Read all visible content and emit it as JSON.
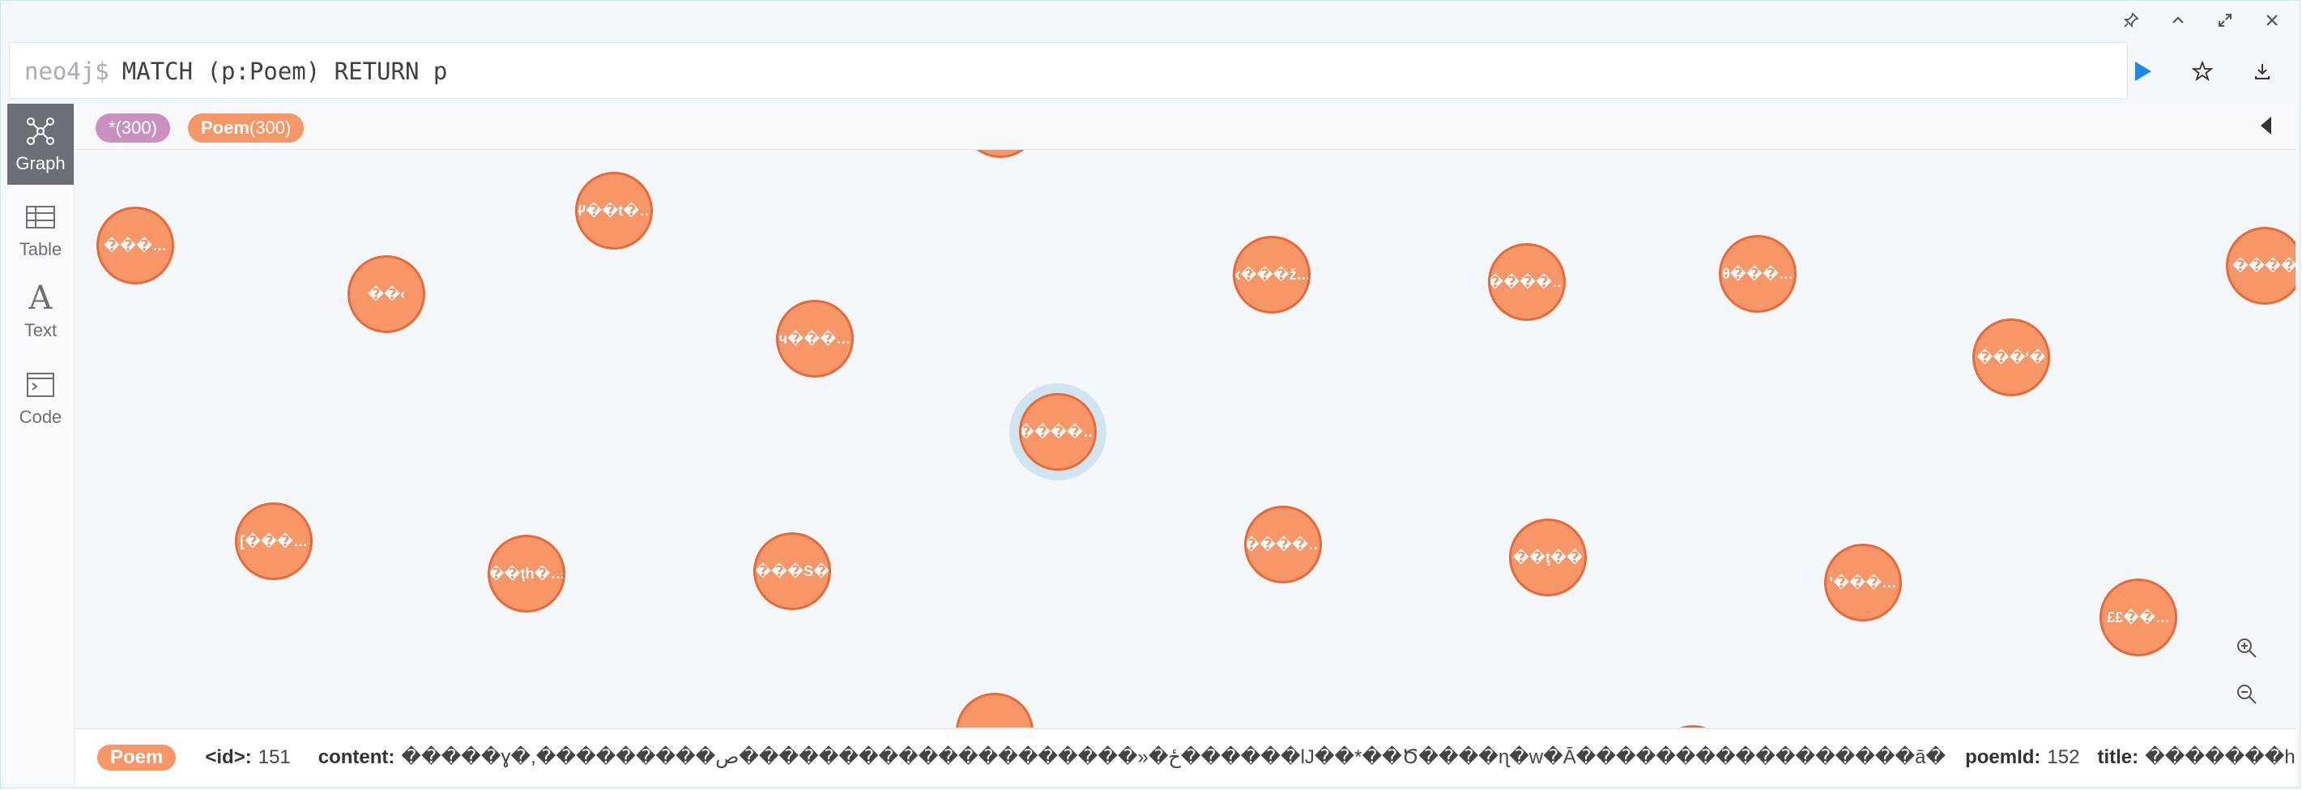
{
  "window_controls": [
    {
      "name": "pin-icon",
      "glyph": "📌"
    },
    {
      "name": "collapse-icon",
      "glyph": "⌃"
    },
    {
      "name": "fullscreen-icon",
      "glyph": "⤢"
    },
    {
      "name": "close-icon",
      "glyph": "✕"
    }
  ],
  "editor": {
    "prompt": "neo4j$",
    "query": "MATCH (p:Poem) RETURN p"
  },
  "rail": {
    "items": [
      {
        "label": "Graph",
        "icon": "graph-icon",
        "active": true
      },
      {
        "label": "Table",
        "icon": "table-icon",
        "active": false
      },
      {
        "label": "Text",
        "icon": "text-icon",
        "active": false
      },
      {
        "label": "Code",
        "icon": "code-icon",
        "active": false
      }
    ]
  },
  "strip": {
    "all_pill": {
      "label": "*",
      "count": "(300)",
      "color": "#c990c0"
    },
    "poem_pill": {
      "label": "Poem",
      "count": "(300)",
      "color": "#f79767"
    }
  },
  "nodes": [
    "���…",
    "Ψ��t�…",
    "��‹",
    "ч���…",
    "x���ž…",
    "����…",
    "θ���…",
    "���‘�",
    "����",
    "����…",
    "[���…",
    "��ţh�…",
    "���S�",
    "����…",
    "��ţ��",
    "'���…",
    "££��…",
    "",
    ""
  ],
  "details": {
    "label": "Poem",
    "id_key": "<id>:",
    "id_val": "151",
    "content_key": "content:",
    "content_val": "�����ɣ�,���������ځ�«��������������������ص������lJ��*��Ծ����ɳ�ԝ�Ā�����������������ā�",
    "poemid_key": "poemId:",
    "poemid_val": "152",
    "title_key": "title:",
    "title_val": "�������h"
  },
  "colors": {
    "node_fill": "#f79767",
    "node_border": "#e8693a",
    "selected_halo": "#cfe5f2",
    "run": "#1e88e5"
  }
}
